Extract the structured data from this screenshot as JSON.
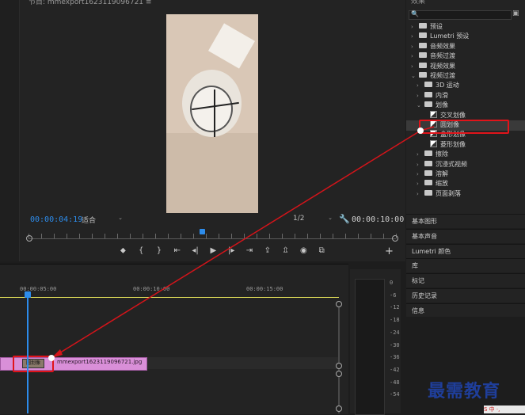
{
  "monitor": {
    "title": "节目: mmexport1623119096721 ≡",
    "current_timecode": "00:00:04:19",
    "fit_label": "适合",
    "resolution_label": "1/2",
    "duration_timecode": "00:00:10:00",
    "transport_icons": [
      "marker-icon",
      "in-point-icon",
      "out-point-icon",
      "go-to-in-icon",
      "step-back-icon",
      "play-icon",
      "step-forward-icon",
      "go-to-out-icon",
      "lift-icon",
      "extract-icon",
      "export-frame-icon",
      "compare-icon"
    ],
    "transport_glyphs": [
      "⬥",
      "{",
      "}",
      "⇤",
      "◂|",
      "▶",
      "|▸",
      "⇥",
      "⇪",
      "⇫",
      "◉",
      "⧉"
    ],
    "add_button": "+"
  },
  "timeline": {
    "time_labels": [
      "00:00:05:00",
      "00:00:10:00",
      "00:00:15:00"
    ],
    "clip_name": "mmexport1623119096721.jpg",
    "transition_label": "圆划像"
  },
  "meter": {
    "labels": [
      "0",
      "-6",
      "-12",
      "-18",
      "-24",
      "-30",
      "-36",
      "-42",
      "-48",
      "-54"
    ]
  },
  "effects": {
    "title": "效果",
    "search_icon": "🔍",
    "tools": "▣",
    "tree": [
      {
        "label": "预设",
        "type": "folder",
        "level": 0,
        "arrow": "›"
      },
      {
        "label": "Lumetri 预设",
        "type": "folder",
        "level": 0,
        "arrow": "›"
      },
      {
        "label": "音频效果",
        "type": "folder",
        "level": 0,
        "arrow": "›"
      },
      {
        "label": "音频过渡",
        "type": "folder",
        "level": 0,
        "arrow": "›"
      },
      {
        "label": "视频效果",
        "type": "folder",
        "level": 0,
        "arrow": "›"
      },
      {
        "label": "视频过渡",
        "type": "folder",
        "level": 0,
        "arrow": "⌄"
      },
      {
        "label": "3D 运动",
        "type": "folder",
        "level": 1,
        "arrow": "›"
      },
      {
        "label": "内滑",
        "type": "folder",
        "level": 1,
        "arrow": "›"
      },
      {
        "label": "划像",
        "type": "folder",
        "level": 1,
        "arrow": "⌄"
      },
      {
        "label": "交叉划像",
        "type": "fx",
        "level": 2,
        "arrow": ""
      },
      {
        "label": "圆划像",
        "type": "fx",
        "level": 2,
        "arrow": ""
      },
      {
        "label": "盒形划像",
        "type": "fx",
        "level": 2,
        "arrow": ""
      },
      {
        "label": "菱形划像",
        "type": "fx",
        "level": 2,
        "arrow": ""
      },
      {
        "label": "擦除",
        "type": "folder",
        "level": 1,
        "arrow": "›"
      },
      {
        "label": "沉浸式视频",
        "type": "folder",
        "level": 1,
        "arrow": "›"
      },
      {
        "label": "溶解",
        "type": "folder",
        "level": 1,
        "arrow": "›"
      },
      {
        "label": "缩放",
        "type": "folder",
        "level": 1,
        "arrow": "›"
      },
      {
        "label": "页面剥落",
        "type": "folder",
        "level": 1,
        "arrow": "›"
      }
    ]
  },
  "panels": [
    "基本图形",
    "基本声音",
    "Lumetri 颜色",
    "库",
    "标记",
    "历史记录",
    "信息"
  ],
  "watermark": {
    "text": "最需教育",
    "badge": "S 中 ·,"
  }
}
